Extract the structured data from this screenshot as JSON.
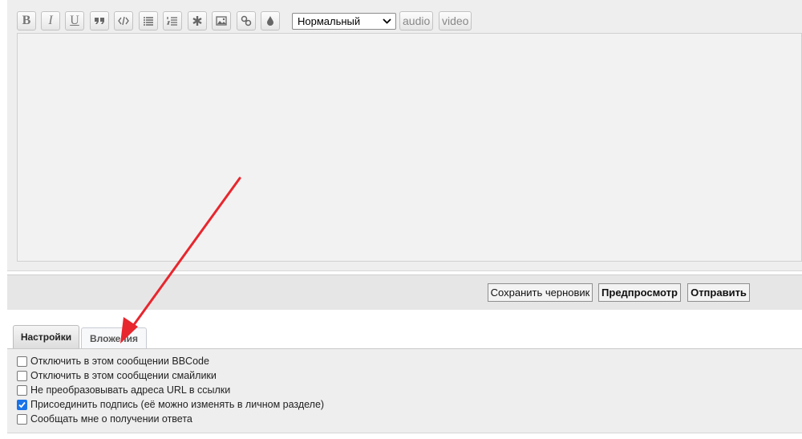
{
  "toolbar": {
    "bold_label": "B",
    "italic_label": "I",
    "underline_label": "U",
    "size_select_value": "Нормальный",
    "audio_label": "audio",
    "video_label": "video",
    "icons": [
      "bold-icon",
      "italic-icon",
      "underline-icon",
      "quote-icon",
      "code-icon",
      "list-icon",
      "numbered-list-icon",
      "star-icon",
      "image-icon",
      "link-icon",
      "color-drop-icon"
    ]
  },
  "actions": {
    "save_draft": "Сохранить черновик",
    "preview": "Предпросмотр",
    "submit": "Отправить"
  },
  "tabs": [
    {
      "label": "Настройки",
      "active": true
    },
    {
      "label": "Вложения",
      "active": false
    }
  ],
  "options": [
    {
      "label": "Отключить в этом сообщении BBCode",
      "checked": false
    },
    {
      "label": "Отключить в этом сообщении смайлики",
      "checked": false
    },
    {
      "label": "Не преобразовывать адреса URL в ссылки",
      "checked": false
    },
    {
      "label": "Присоединить подпись (её можно изменять в личном разделе)",
      "checked": true
    },
    {
      "label": "Сообщать мне о получении ответа",
      "checked": false
    }
  ],
  "colors": {
    "annotation_arrow": "#e8262e",
    "checkbox_checked": "#1a73e8"
  }
}
